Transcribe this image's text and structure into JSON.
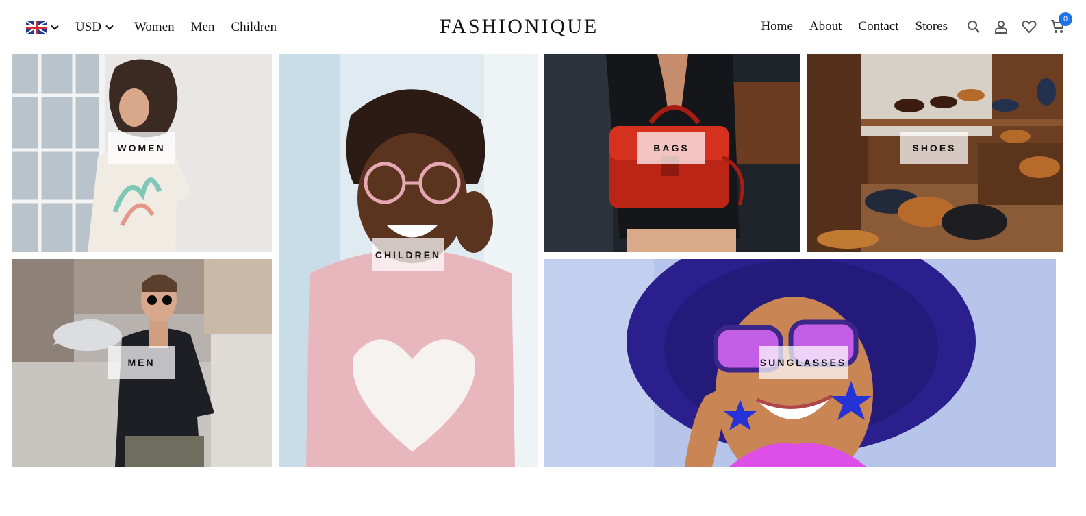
{
  "brand": {
    "logo": "FASHIONIQUE"
  },
  "header": {
    "currency": "USD",
    "left_links": [
      "Women",
      "Men",
      "Children"
    ],
    "right_links": [
      "Home",
      "About",
      "Contact",
      "Stores"
    ],
    "cart_count": "0"
  },
  "icons": {
    "flag": "uk-flag-icon",
    "dropdown": "chevron-down-icon",
    "search": "search-icon",
    "account": "user-icon",
    "wishlist": "heart-icon",
    "cart": "cart-icon"
  },
  "colors": {
    "badge": "#1a73e8",
    "text": "#111111",
    "label_bg": "rgba(255,255,255,0.72)"
  },
  "categories": [
    {
      "id": "women",
      "label": "WOMEN"
    },
    {
      "id": "children",
      "label": "CHILDREN"
    },
    {
      "id": "bags",
      "label": "BAGS"
    },
    {
      "id": "shoes",
      "label": "SHOES"
    },
    {
      "id": "men",
      "label": "MEN"
    },
    {
      "id": "sunglasses",
      "label": "SUNGLASSES"
    }
  ]
}
